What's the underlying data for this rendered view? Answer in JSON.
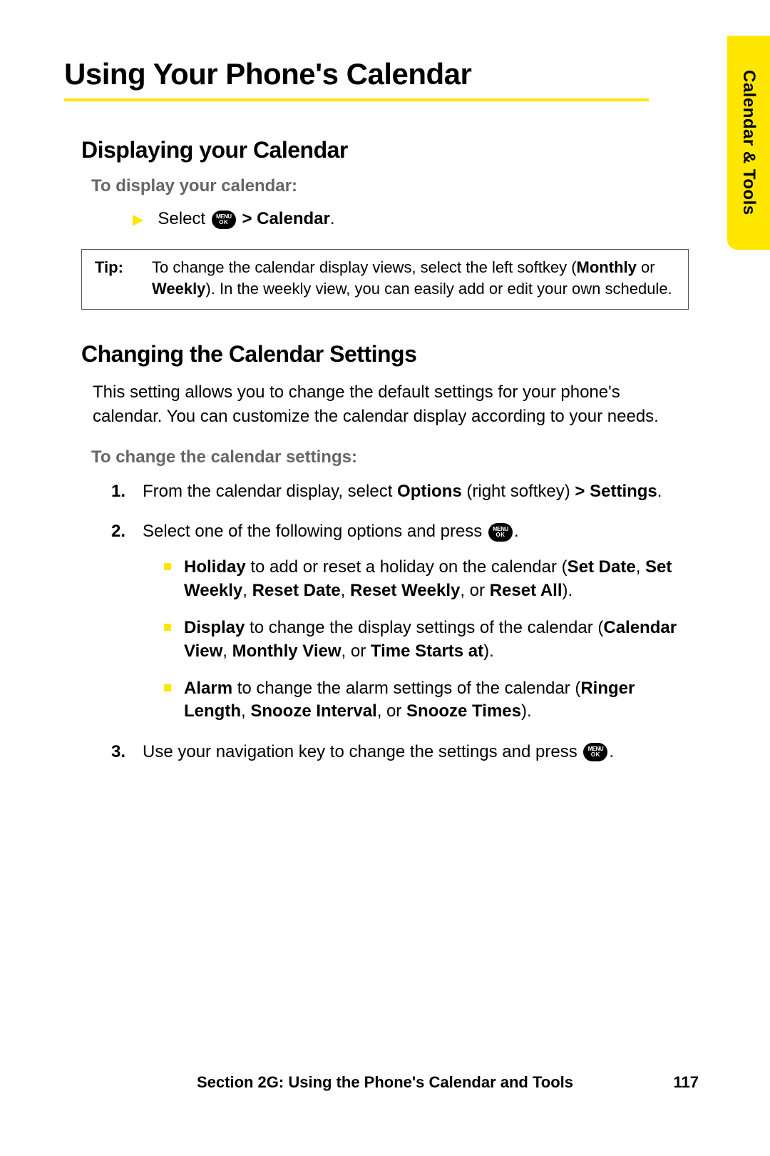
{
  "sideTab": "Calendar & Tools",
  "title": "Using Your Phone's Calendar",
  "section1": {
    "heading": "Displaying your Calendar",
    "leadin": "To display your calendar:",
    "step_prefix": "Select",
    "step_suffix": " > Calendar",
    "step_period": "."
  },
  "tip": {
    "label": "Tip:",
    "text_a": "To change the calendar display views, select the left softkey (",
    "bold_a": "Monthly",
    "text_b": " or ",
    "bold_b": "Weekly",
    "text_c": "). In the weekly view, you can easily add or edit your own schedule."
  },
  "section2": {
    "heading": "Changing the Calendar Settings",
    "intro": "This setting allows you to change the default settings for your phone's calendar. You can customize the calendar display according to your needs.",
    "leadin": "To change the calendar settings:",
    "step1_a": "From the calendar display, select ",
    "step1_b": "Options",
    "step1_c": " (right softkey) ",
    "step1_d": "> Settings",
    "step1_e": ".",
    "step2_a": "Select one of the following options and press ",
    "step2_b": ".",
    "bullet1": {
      "b1": "Holiday",
      "t1": " to add or reset a holiday on the calendar (",
      "b2": "Set Date",
      "c1": ", ",
      "b3": "Set Weekly",
      "c2": ", ",
      "b4": "Reset Date",
      "c3": ", ",
      "b5": "Reset Weekly",
      "c4": ", or ",
      "b6": "Reset All",
      "t2": ")."
    },
    "bullet2": {
      "b1": "Display",
      "t1": " to change the display settings of the calendar (",
      "b2": "Calendar View",
      "c1": ", ",
      "b3": "Monthly View",
      "c2": ", or ",
      "b4": "Time Starts at",
      "t2": ")."
    },
    "bullet3": {
      "b1": "Alarm",
      "t1": " to change the alarm settings of the calendar (",
      "b2": "Ringer Length",
      "c1": ", ",
      "b3": "Snooze Interval",
      "c2": ", or ",
      "b4": "Snooze Times",
      "t2": ")."
    },
    "step3_a": "Use your navigation key to change the settings and press ",
    "step3_b": "."
  },
  "footer": {
    "text": "Section 2G: Using the Phone's Calendar and Tools",
    "page": "117"
  },
  "menuok": {
    "top": "MENU",
    "bottom": "OK"
  }
}
